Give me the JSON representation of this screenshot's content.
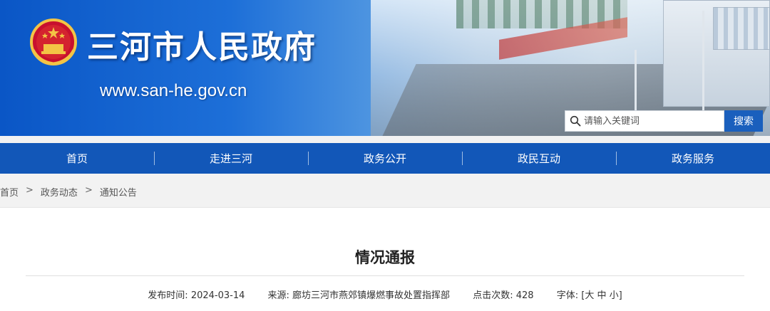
{
  "header": {
    "site_title": "三河市人民政府",
    "site_url": "www.san-he.gov.cn",
    "search": {
      "placeholder": "请输入关键词",
      "button_label": "搜索"
    }
  },
  "nav": {
    "items": [
      {
        "label": "首页"
      },
      {
        "label": "走进三河"
      },
      {
        "label": "政务公开"
      },
      {
        "label": "政民互动"
      },
      {
        "label": "政务服务"
      }
    ]
  },
  "breadcrumb": {
    "items": [
      "首页",
      "政务动态",
      "通知公告"
    ],
    "separator": ">"
  },
  "article": {
    "title": "情况通报",
    "publish_label": "发布时间:",
    "publish_date": "2024-03-14",
    "source_label": "来源:",
    "source": "廊坊三河市燕郊镇爆燃事故处置指挥部",
    "clicks_label": "点击次数:",
    "clicks": "428",
    "font_label": "字体:",
    "font_open": "[",
    "font_large": "大",
    "font_medium": "中",
    "font_small": "小",
    "font_close": "]"
  },
  "colors": {
    "nav_bg": "#1257b8",
    "search_button": "#1a5fbd",
    "banner_blue": "#0a56c6"
  }
}
